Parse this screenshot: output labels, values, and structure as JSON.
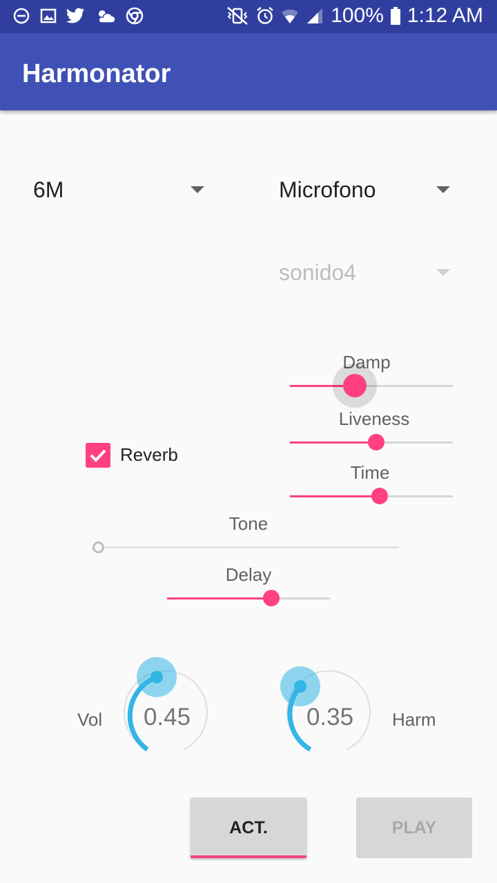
{
  "status_bar": {
    "battery": "100%",
    "time": "1:12 AM"
  },
  "app": {
    "title": "Harmonator"
  },
  "spinners": {
    "mode": "6M",
    "input": "Microfono",
    "sound": "sonido4"
  },
  "reverb": {
    "label": "Reverb",
    "checked": true,
    "damp": {
      "label": "Damp",
      "level": 0.4
    },
    "liveness": {
      "label": "Liveness",
      "level": 0.53
    },
    "time": {
      "label": "Time",
      "level": 0.55
    }
  },
  "tone": {
    "label": "Tone",
    "level": 0.0
  },
  "delay": {
    "label": "Delay",
    "level": 0.64
  },
  "knobs": {
    "vol": {
      "label": "Vol",
      "value": "0.45"
    },
    "harm": {
      "label": "Harm",
      "value": "0.35"
    }
  },
  "buttons": {
    "act": "ACT.",
    "play": "PLAY"
  },
  "colors": {
    "primary": "#3f51b5",
    "primary_dark": "#303f9f",
    "accent": "#ff4081",
    "knob": "#33b5e5"
  }
}
